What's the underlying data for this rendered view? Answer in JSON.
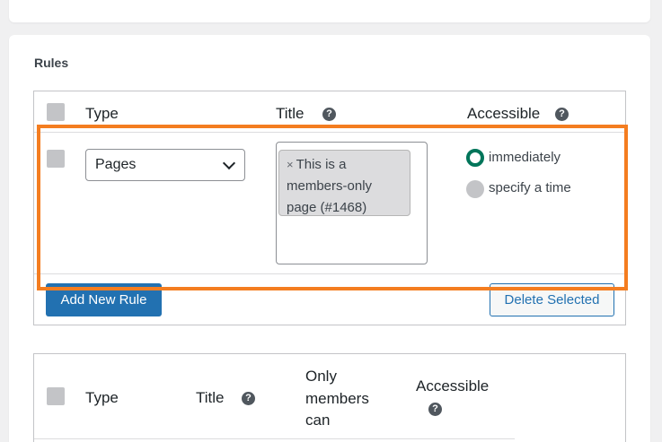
{
  "rules_section": {
    "heading": "Rules"
  },
  "rules_table": {
    "columns": {
      "type": "Type",
      "title": "Title",
      "accessible": "Accessible"
    },
    "row": {
      "type_select": {
        "selected": "Pages"
      },
      "title_token": "This is a members-only page (#1468)",
      "title_token_lines": [
        "This is a",
        "members-only",
        "page (#1468)"
      ],
      "token_remove": "×",
      "radio_options": [
        {
          "label": "immediately",
          "checked": true
        },
        {
          "label": "specify a time",
          "checked": false
        }
      ]
    },
    "buttons": {
      "add_new_rule": "Add New Rule",
      "delete_selected": "Delete Selected"
    }
  },
  "second_table": {
    "columns": {
      "type": "Type",
      "title": "Title",
      "only_members_lines": [
        "Only",
        "members",
        "can"
      ],
      "accessible": "Accessible"
    }
  },
  "help_glyph": "?",
  "colors": {
    "primary": "#2271b1",
    "radio_checked": "#00755a",
    "highlight": "#f47d20"
  },
  "icons": [
    "help-icon",
    "chevron-down-icon",
    "remove-token-icon"
  ]
}
